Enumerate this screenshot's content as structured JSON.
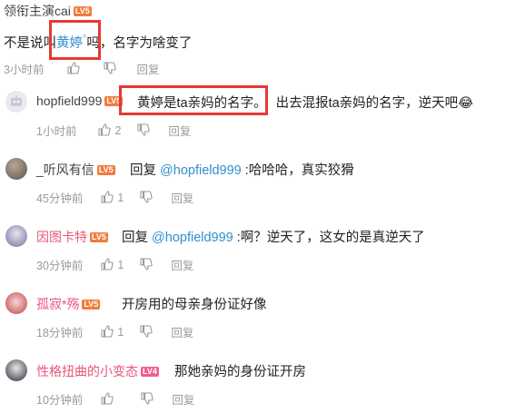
{
  "main_comment": {
    "username": "领衔主演cai",
    "level": "LV5",
    "text_before": "不是说叫",
    "highlight": "黄婷",
    "search_mark": "°",
    "text_after": "吗，名字为啥变了",
    "time": "3小时前",
    "reply_label": "回复"
  },
  "replies": [
    {
      "username": "hopfield999",
      "level": "LV5",
      "highlight": "黄婷是ta亲妈的名字。",
      "text": "出去混报ta亲妈的名字，逆天吧",
      "emoji": "😂",
      "time": "1小时前",
      "likes": "2",
      "reply_label": "回复"
    },
    {
      "username": "_听风有信",
      "level": "LV5",
      "prefix": "回复 ",
      "mention": "@hopfield999",
      "text": " :哈哈哈，真实狡猾",
      "time": "45分钟前",
      "likes": "1",
      "reply_label": "回复"
    },
    {
      "username": "因图卡特",
      "level": "LV5",
      "prefix": "回复 ",
      "mention": "@hopfield999",
      "text": " :啊？逆天了，这女的是真逆天了",
      "time": "30分钟前",
      "likes": "1",
      "reply_label": "回复"
    },
    {
      "username": "孤寂*殇",
      "level": "LV5",
      "text": "开房用的母亲身份证好像",
      "time": "18分钟前",
      "likes": "1",
      "reply_label": "回复"
    },
    {
      "username": "性格扭曲的小变态",
      "level": "LV4",
      "text": "那她亲妈的身份证开房",
      "time": "10分钟前",
      "likes": "",
      "reply_label": "回复"
    }
  ],
  "icons": {
    "like": "thumbs-up-icon",
    "dislike": "thumbs-down-icon"
  },
  "colors": {
    "level_orange": "#f27c3c",
    "level_pink": "#f25d8e",
    "mention_blue": "#2f8fd0",
    "highlight_box": "#e53935",
    "pink_name": "#e8567a"
  }
}
